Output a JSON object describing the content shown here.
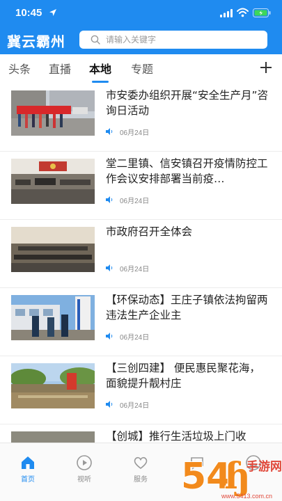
{
  "status": {
    "time": "10:45"
  },
  "header": {
    "brand": "冀云霸州",
    "search_placeholder": "请输入关键字"
  },
  "tabs": [
    {
      "label": "头条",
      "active": false
    },
    {
      "label": "直播",
      "active": false
    },
    {
      "label": "本地",
      "active": true
    },
    {
      "label": "专题",
      "active": false
    }
  ],
  "news": [
    {
      "title": "市安委办组织开展“安全生产月”咨询日活动",
      "date": "06月24日"
    },
    {
      "title": "堂二里镇、信安镇召开疫情防控工作会议安排部署当前疫…",
      "date": "06月24日"
    },
    {
      "title": "市政府召开全体会",
      "date": "06月24日"
    },
    {
      "title": "【环保动态】王庄子镇依法拘留两违法生产企业主",
      "date": "06月24日"
    },
    {
      "title": "【三创四建】 便民惠民聚花海，面貌提升靓村庄",
      "date": "06月24日"
    },
    {
      "title": "【创城】推行生活垃圾上门收",
      "date": ""
    }
  ],
  "bottom_nav": [
    {
      "label": "首页",
      "icon": "home-icon",
      "active": true
    },
    {
      "label": "视听",
      "icon": "play-icon",
      "active": false
    },
    {
      "label": "服务",
      "icon": "heart-icon",
      "active": false
    },
    {
      "label": "",
      "icon": "chat-icon",
      "active": false
    },
    {
      "label": "",
      "icon": "user-icon",
      "active": false
    }
  ],
  "watermark": {
    "digits": "54",
    "brand": "手游网",
    "url": "www.5413.com.cn"
  },
  "colors": {
    "accent": "#1f8bf0",
    "text": "#222222",
    "muted": "#888888"
  }
}
